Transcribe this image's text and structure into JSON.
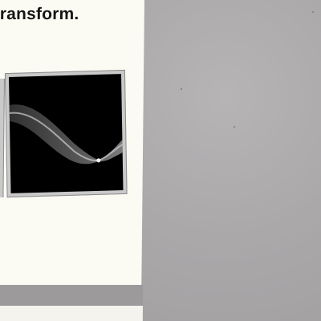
{
  "document": {
    "caption_fragment": "ransform."
  },
  "figure": {
    "background": "#000000",
    "frame_color": "#c9c9c9",
    "curve_color": "#bdbdbd"
  },
  "colors": {
    "paper": "#fbfaf3",
    "desk": "#a9a7a8"
  }
}
